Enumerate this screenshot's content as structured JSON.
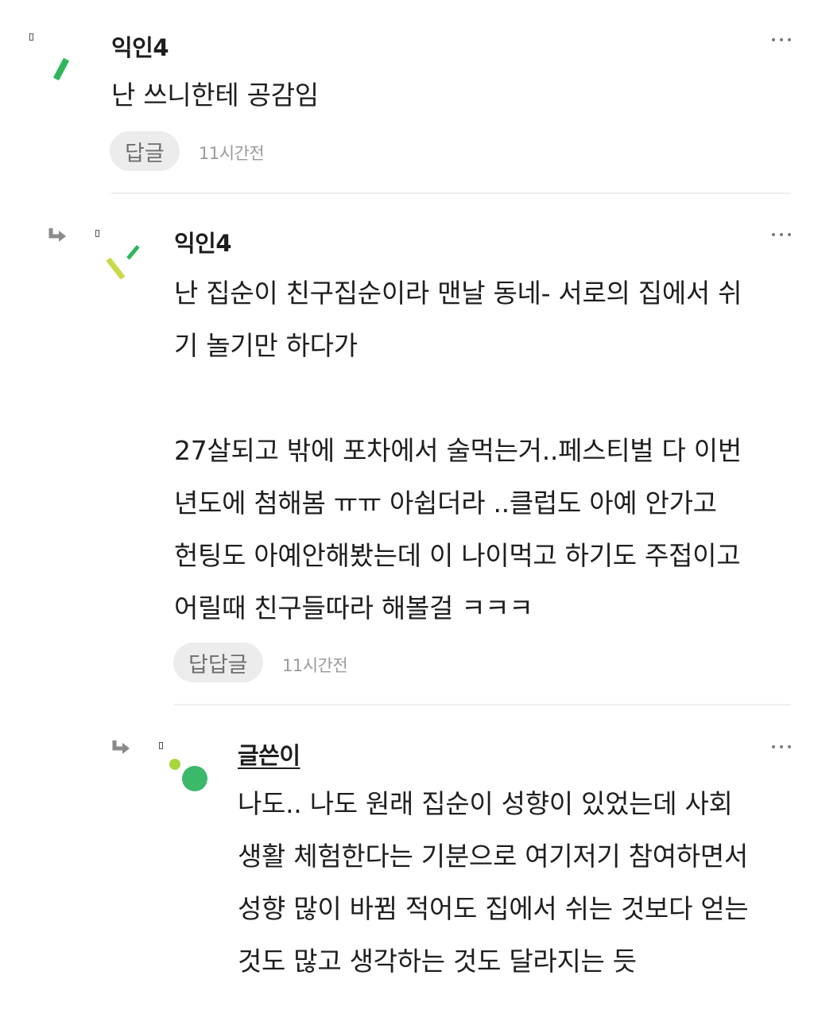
{
  "comments": [
    {
      "author": "익인4",
      "body": "난 쓰니한테 공감임",
      "reply_label": "답글",
      "time": "11시간전",
      "avatar_icon": "confetti-avatar-icon",
      "accent_colors": [
        "#2fb65a"
      ]
    },
    {
      "author": "익인4",
      "body": "난 집순이 친구집순이라 맨날 동네- 서로의 집에서 쉬\n기 놀기만 하다가\n\n27살되고 밖에 포차에서 술먹는거..페스티벌 다 이번\n년도에 첨해봄 ㅠㅠ 아쉽더라 ..클럽도 아예 안가고\n헌팅도 아예안해봤는데 이 나이먹고 하기도 주접이고\n어릴때 친구들따라 해볼걸 ㅋㅋㅋ",
      "reply_label": "답답글",
      "time": "11시간전",
      "avatar_icon": "confetti-avatar-icon",
      "accent_colors": [
        "#2fb65a",
        "#c9d94a"
      ]
    },
    {
      "author": "글쓴이",
      "body": "나도.. 나도 원래 집순이 성향이 있었는데 사회\n생활 체험한다는 기분으로 여기저기 참여하면서\n성향 많이 바뀜 적어도 집에서 쉬는 것보다 얻는\n것도 많고 생각하는 것도 달라지는 듯",
      "avatar_icon": "dots-avatar-icon",
      "accent_colors": [
        "#3cb86a",
        "#a8d63a"
      ]
    }
  ],
  "icons": {
    "reply_arrow": "reply-arrow-icon",
    "more": "more-options-icon"
  }
}
